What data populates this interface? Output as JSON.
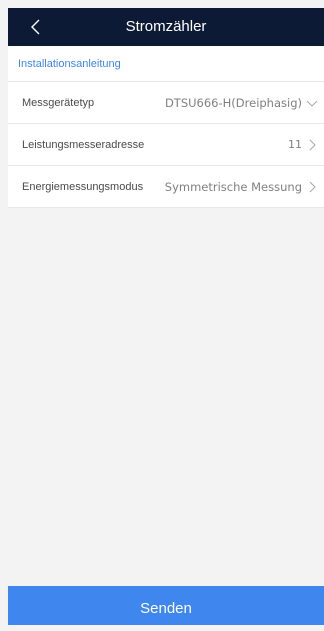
{
  "header": {
    "title": "Stromzähler",
    "back_icon": "chevron-left-icon"
  },
  "install_link": "Installationsanleitung",
  "settings": [
    {
      "label": "Messgerätetyp",
      "value": "DTSU666-H(Dreiphasig)",
      "icon": "chevron-down-icon"
    },
    {
      "label": "Leistungsmesseradresse",
      "value": "11",
      "icon": "chevron-right-icon"
    },
    {
      "label": "Energiemessungsmodus",
      "value": "Symmetrische Messung",
      "icon": "chevron-right-icon"
    }
  ],
  "submit_label": "Senden",
  "colors": {
    "header_bg": "#0d1a36",
    "accent": "#3f86ef",
    "page_bg": "#f3f3f4"
  }
}
